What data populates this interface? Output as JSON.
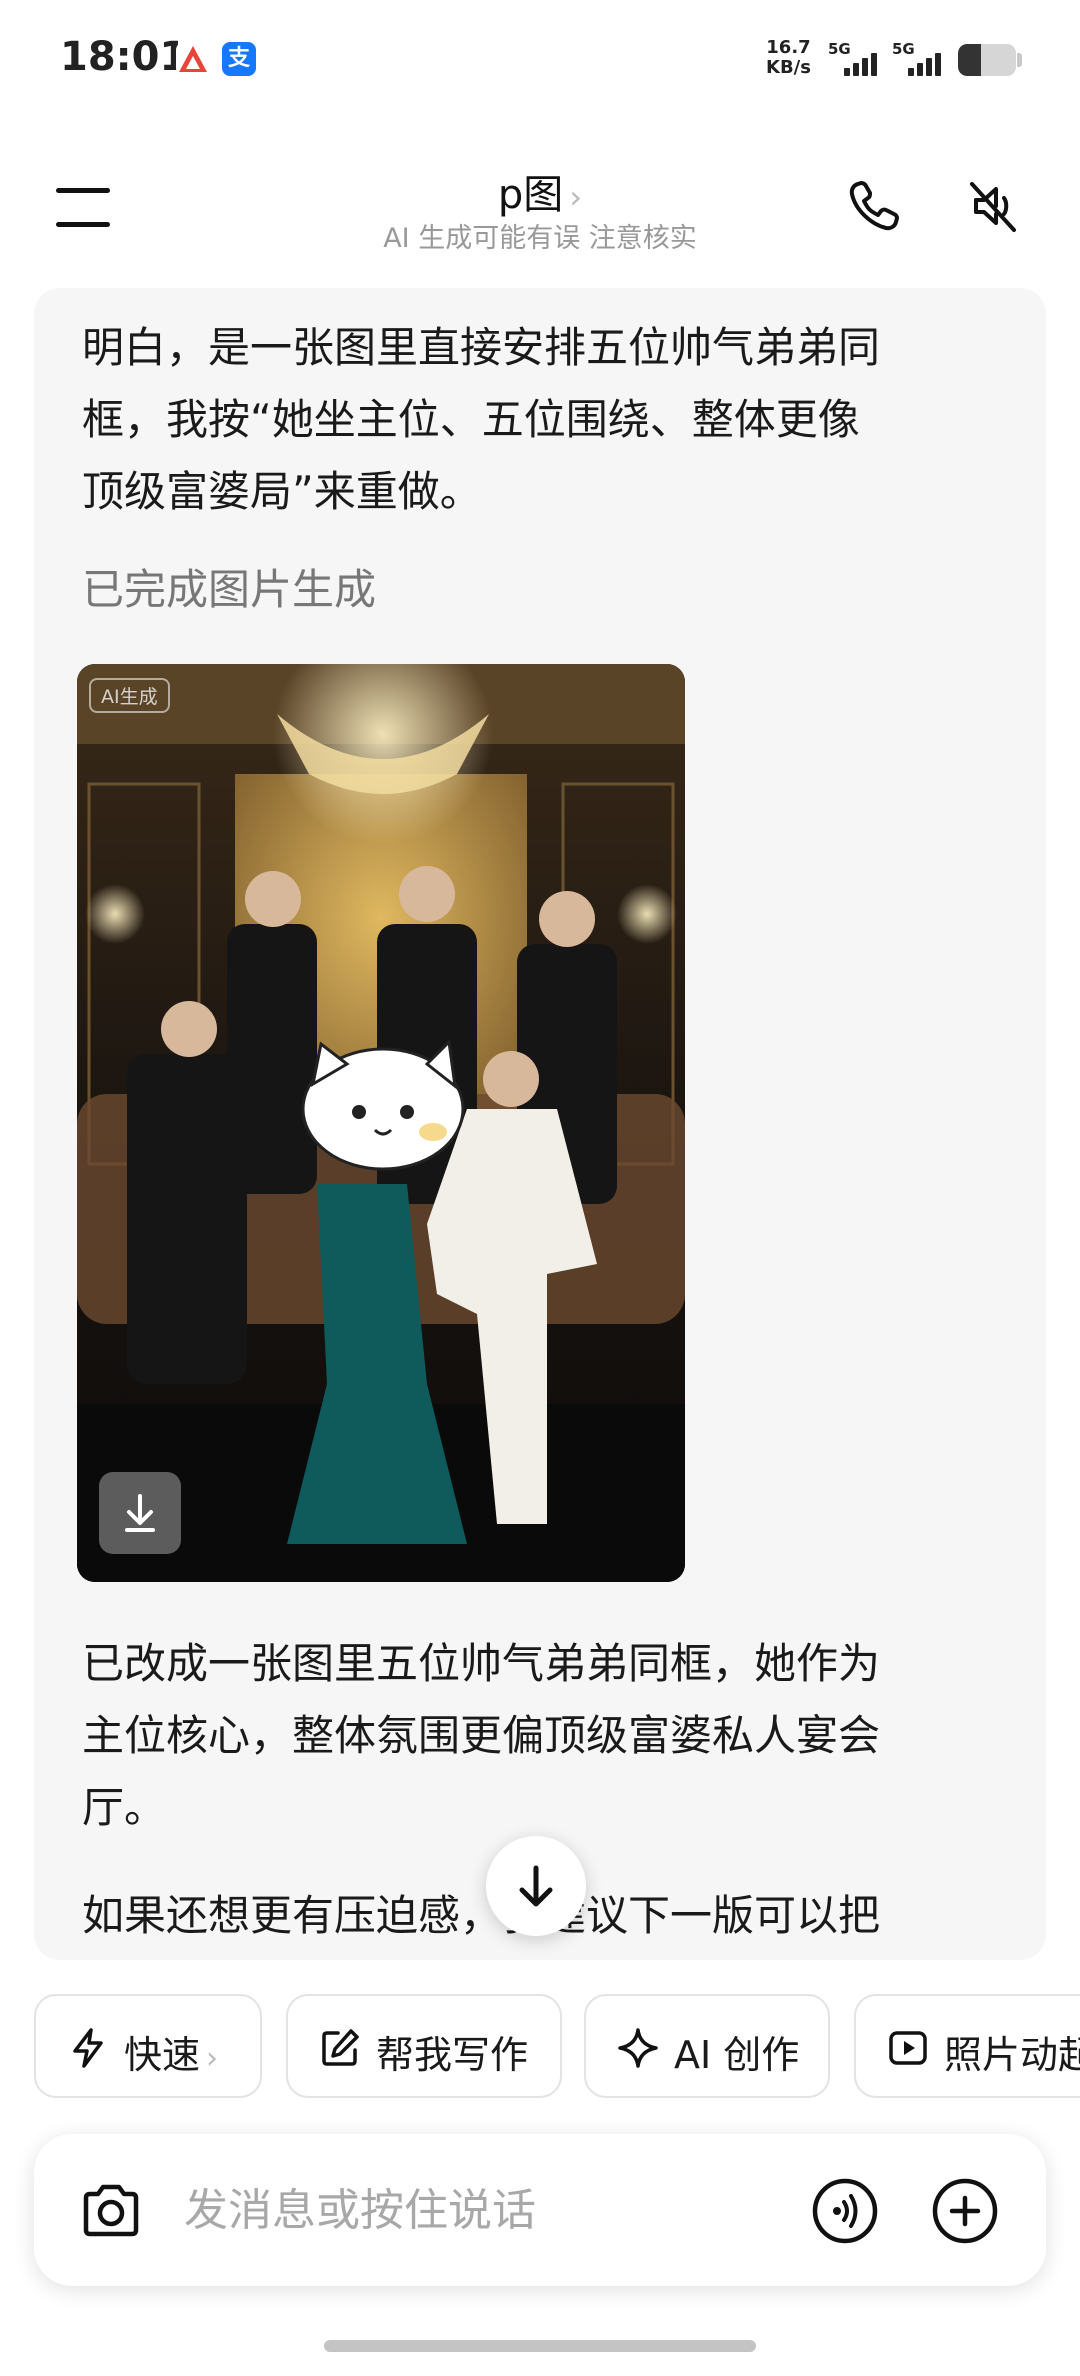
{
  "status_bar": {
    "time": "18:01",
    "net_speed_value": "16.7",
    "net_speed_unit": "KB/s",
    "signal1_label": "5G",
    "signal2_label": "5G",
    "alipay_badge": "支",
    "battery_level": 0.4
  },
  "header": {
    "title": "p图",
    "title_chevron": "›",
    "subtitle": "AI 生成可能有误 注意核实",
    "icons": [
      "menu-icon",
      "phone-icon",
      "mute-icon"
    ]
  },
  "chat": {
    "intro_lines": [
      "明白，是一张图里直接安排五位帅气弟弟同",
      "框，我按“她坐主位、五位围绕、整体更像",
      "顶级富婆局”来重做。"
    ],
    "image_status": "已完成图片生成",
    "image_badge": "AI生成",
    "result_lines": [
      "已改成一张图里五位帅气弟弟同框，她作为",
      "主位核心，整体氛围更偏顶级富婆私人宴会",
      "厅。"
    ],
    "followup_line": "如果还想更有压迫感，我建议下一版可以把"
  },
  "chips": [
    {
      "label": "快速",
      "icon": "lightning-icon",
      "chevron": "›"
    },
    {
      "label": "帮我写作",
      "icon": "edit-icon"
    },
    {
      "label": "AI 创作",
      "icon": "sparkle-icon"
    },
    {
      "label": "照片动起来",
      "icon": "play-icon"
    }
  ],
  "input": {
    "placeholder": "发消息或按住说话",
    "value": ""
  },
  "colors": {
    "accent_blue": "#1677ff",
    "card_bg": "#f6f6f7",
    "text": "#1a1a1a",
    "muted": "#999999"
  }
}
